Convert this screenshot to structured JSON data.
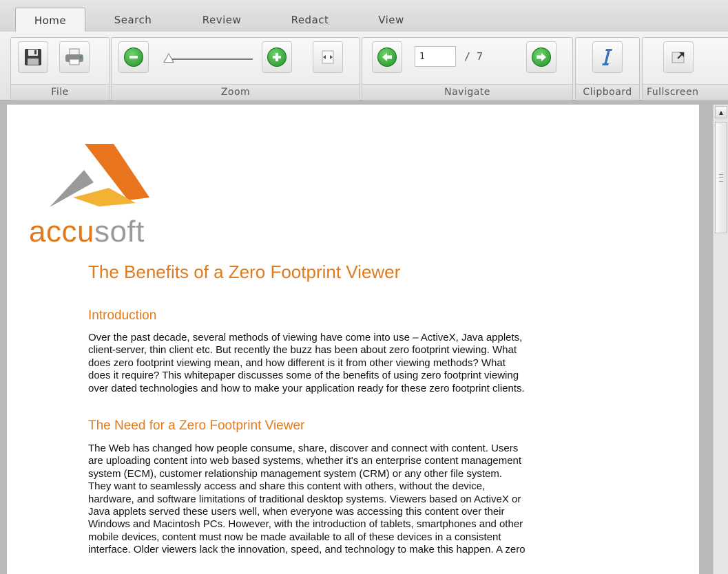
{
  "tabs": [
    "Home",
    "Search",
    "Review",
    "Redact",
    "View"
  ],
  "ribbon": {
    "groups": {
      "file": "File",
      "zoom": "Zoom",
      "navigate": "Navigate",
      "clipboard": "Clipboard",
      "fullscreen": "Fullscreen"
    },
    "icons": {
      "save": "save-icon",
      "print": "print-icon",
      "zoom_out": "zoom-out-icon",
      "zoom_in": "zoom-in-icon",
      "fit_width": "fit-width-icon",
      "prev_page": "previous-page-icon",
      "next_page": "next-page-icon",
      "text_select": "text-select-icon",
      "fullscreen": "fullscreen-icon"
    },
    "navigate": {
      "current_page": "1",
      "total_pages": "/ 7"
    },
    "zoom_level_fraction": 0.0
  },
  "document": {
    "logo": {
      "word_orange": "accu",
      "word_gray": "soft"
    },
    "title": "The Benefits of a Zero Footprint Viewer",
    "sections": [
      {
        "heading": "Introduction",
        "lines": [
          "Over the past decade, several methods of viewing have come into use – ActiveX, Java applets,",
          "client-server, thin client etc. But recently the buzz has been about zero footprint viewing. What",
          "does zero footprint viewing mean, and how different is it from other viewing methods?  What",
          "does it require? This whitepaper discusses some of the benefits of using zero footprint viewing",
          "over dated technologies and how to make your application ready for these zero footprint clients."
        ]
      },
      {
        "heading": "The Need for a Zero Footprint Viewer",
        "lines": [
          "The Web has changed how people consume, share, discover and connect with content. Users",
          "are uploading content into web based systems, whether it's an enterprise content management",
          "system (ECM), customer relationship management system (CRM) or any other file system.",
          "They want to seamlessly access and share this content with others, without the device,",
          "hardware, and software limitations of traditional desktop systems.  Viewers based on ActiveX or",
          "Java applets served these users well, when everyone was accessing this content over their",
          "Windows and Macintosh PCs. However, with the introduction of tablets, smartphones and other",
          "mobile devices, content must now be made available to all of these devices in a consistent",
          "interface. Older viewers lack the innovation, speed, and technology to make this happen. A zero"
        ]
      }
    ]
  },
  "colors": {
    "accent_orange": "#e07a1e",
    "logo_gray": "#9a9a9a",
    "button_green": "#2ea336"
  }
}
